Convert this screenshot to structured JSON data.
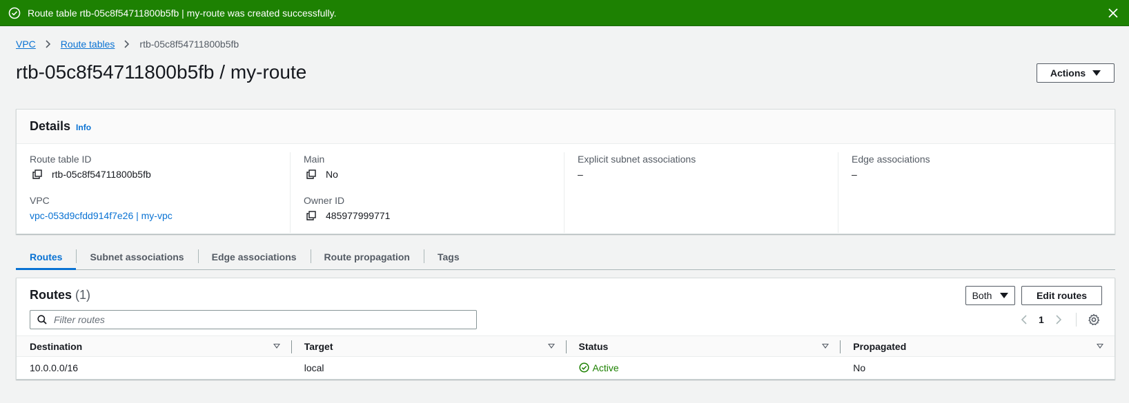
{
  "flash": {
    "message": "Route table rtb-05c8f54711800b5fb | my-route was created successfully.",
    "color": "#1d8102"
  },
  "breadcrumb": {
    "items": [
      "VPC",
      "Route tables"
    ],
    "current": "rtb-05c8f54711800b5fb"
  },
  "page_title": "rtb-05c8f54711800b5fb / my-route",
  "actions_label": "Actions",
  "details": {
    "title": "Details",
    "info": "Info",
    "route_table_id_label": "Route table ID",
    "route_table_id": "rtb-05c8f54711800b5fb",
    "vpc_label": "VPC",
    "vpc": "vpc-053d9cfdd914f7e26 | my-vpc",
    "main_label": "Main",
    "main": "No",
    "owner_label": "Owner ID",
    "owner": "485977999771",
    "explicit_label": "Explicit subnet associations",
    "explicit": "–",
    "edge_label": "Edge associations",
    "edge": "–"
  },
  "tabs": [
    "Routes",
    "Subnet associations",
    "Edge associations",
    "Route propagation",
    "Tags"
  ],
  "routes": {
    "title": "Routes",
    "count": "(1)",
    "both_label": "Both",
    "edit_label": "Edit routes",
    "filter_placeholder": "Filter routes",
    "page": "1",
    "columns": [
      "Destination",
      "Target",
      "Status",
      "Propagated"
    ],
    "rows": [
      {
        "destination": "10.0.0.0/16",
        "target": "local",
        "status": "Active",
        "propagated": "No"
      }
    ]
  },
  "colors": {
    "link": "#0972d3",
    "success": "#1d8102",
    "text": "#16191f"
  }
}
